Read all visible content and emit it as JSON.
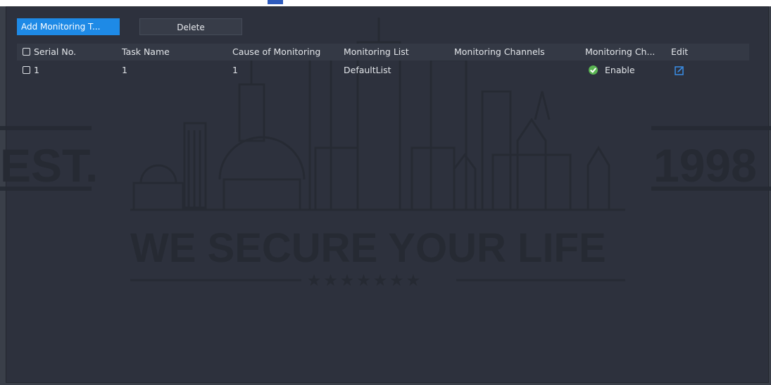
{
  "toolbar": {
    "add_label": "Add Monitoring T...",
    "delete_label": "Delete"
  },
  "table": {
    "headers": {
      "serial": "Serial No.",
      "task_name": "Task Name",
      "cause": "Cause of Monitoring",
      "list": "Monitoring List",
      "channels": "Monitoring Channels",
      "monitoring_ch": "Monitoring Ch...",
      "edit": "Edit"
    },
    "rows": [
      {
        "serial": "1",
        "task_name": "1",
        "cause": "1",
        "list": "DefaultList",
        "channels": "",
        "status": "Enable",
        "status_icon": "check-circle-icon",
        "edit_icon": "edit-icon"
      }
    ]
  },
  "watermark": {
    "left_text": "EST.",
    "right_text": "1998",
    "slogan": "WE SECURE YOUR LIFE",
    "stars": "★ ★ ★ ★ ★ ★ ★"
  },
  "colors": {
    "accent": "#1e8ae6",
    "background": "#2d313d",
    "enable": "#5ab552",
    "edit": "#3a8ee6"
  }
}
